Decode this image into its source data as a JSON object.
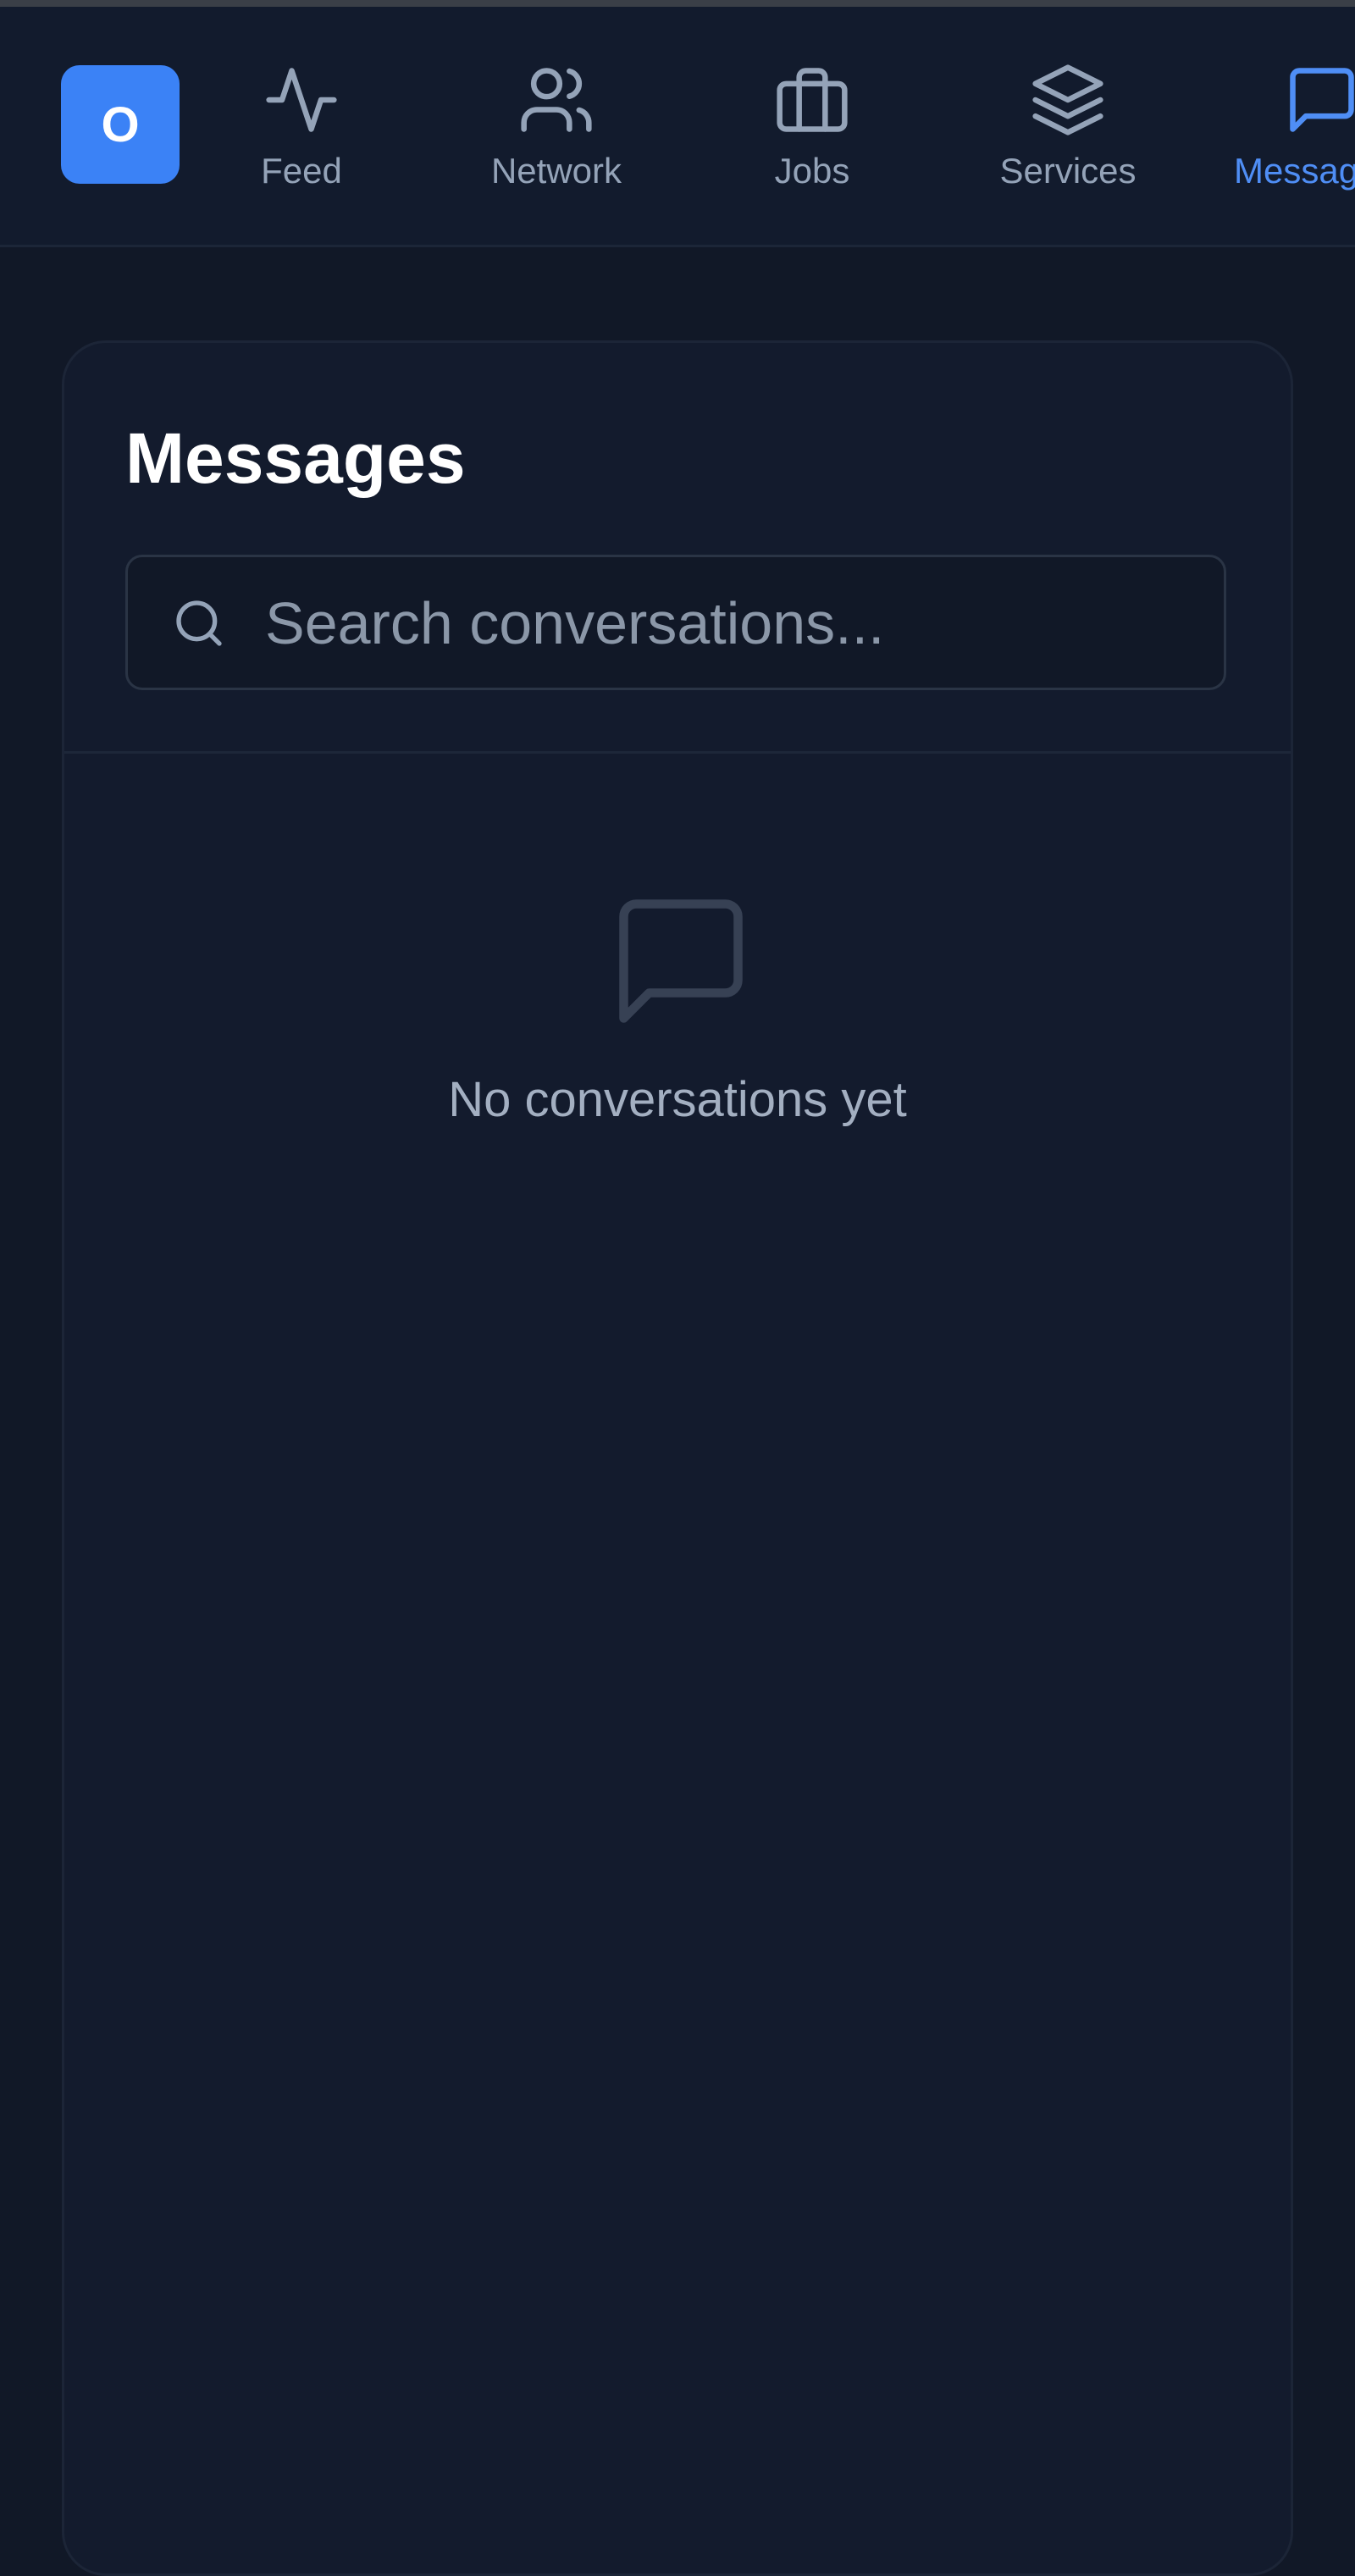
{
  "brand": {
    "logo_letter": "O",
    "logo_color": "#3b82f6"
  },
  "nav": {
    "active_color": "#4f8ef5",
    "items": [
      {
        "label": "Feed",
        "icon": "activity-icon"
      },
      {
        "label": "Network",
        "icon": "users-icon"
      },
      {
        "label": "Jobs",
        "icon": "briefcase-icon"
      },
      {
        "label": "Services",
        "icon": "layers-icon"
      },
      {
        "label": "Messages",
        "icon": "message-square-icon",
        "active": true
      }
    ]
  },
  "messages": {
    "title": "Messages",
    "search_placeholder": "Search conversations...",
    "search_value": "",
    "empty_icon": "message-square-icon",
    "empty_text": "No conversations yet"
  }
}
